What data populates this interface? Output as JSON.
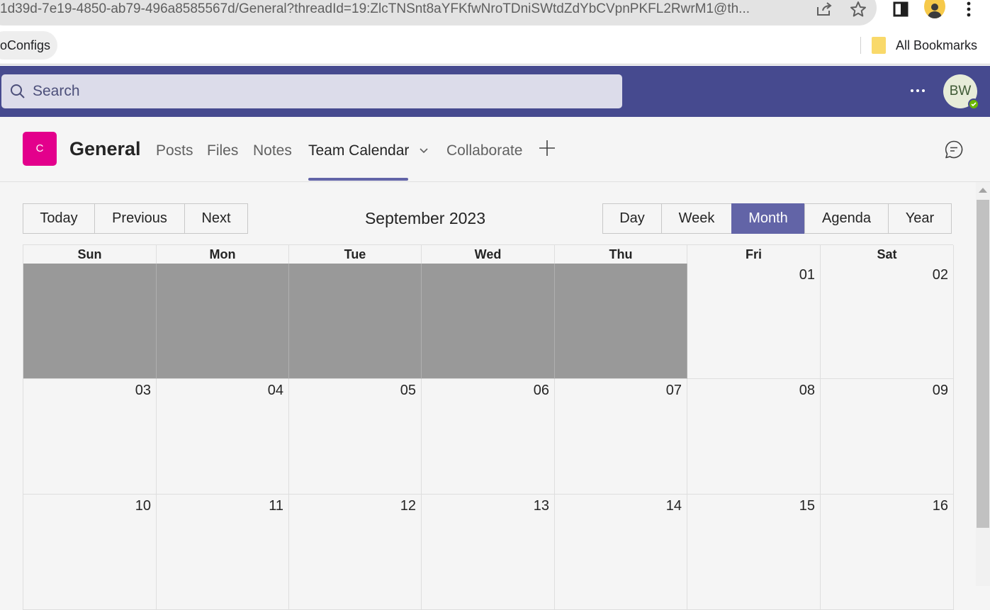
{
  "browser": {
    "url": "1d39d-7e19-4850-ab79-496a8585567d/General?threadId=19:ZlcTNSnt8aYFKfwNroTDniSWtdZdYbCVpnPKFL2RwrM1@th...",
    "icons": [
      "share-icon",
      "star-icon",
      "side-panel-icon",
      "profile-icon",
      "kebab-menu-icon"
    ],
    "bookmark_chip": "oConfigs",
    "all_bookmarks": "All Bookmarks"
  },
  "teams": {
    "search_placeholder": "Search",
    "avatar_initials": "BW",
    "presence_color": "#6bb700",
    "header_color": "#464a8f"
  },
  "channel": {
    "tile_letter": "C",
    "tile_color": "#e3008c",
    "name": "General",
    "tabs": [
      {
        "label": "Posts"
      },
      {
        "label": "Files"
      },
      {
        "label": "Notes"
      },
      {
        "label": "Team Calendar",
        "active": true
      },
      {
        "label": "Collaborate"
      }
    ]
  },
  "calendar": {
    "nav": {
      "today": "Today",
      "previous": "Previous",
      "next": "Next"
    },
    "title": "September 2023",
    "views": {
      "day": "Day",
      "week": "Week",
      "month": "Month",
      "agenda": "Agenda",
      "year": "Year"
    },
    "active_view": "Month",
    "weekdays": [
      "Sun",
      "Mon",
      "Tue",
      "Wed",
      "Thu",
      "Fri",
      "Sat"
    ],
    "weeks": [
      [
        "",
        "",
        "",
        "",
        "",
        "01",
        "02"
      ],
      [
        "03",
        "04",
        "05",
        "06",
        "07",
        "08",
        "09"
      ],
      [
        "10",
        "11",
        "12",
        "13",
        "14",
        "15",
        "16"
      ]
    ],
    "accent_color": "#6264a7"
  }
}
